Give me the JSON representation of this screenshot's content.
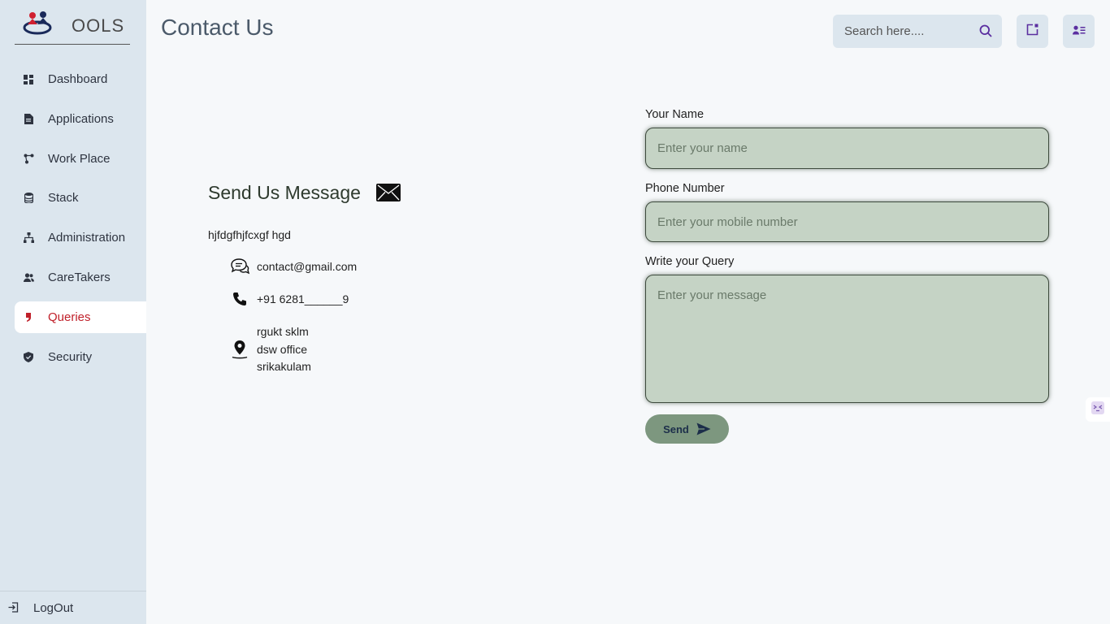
{
  "app": {
    "logo_text": "OOLS"
  },
  "sidebar": {
    "items": [
      {
        "label": "Dashboard",
        "icon": "dashboard-icon"
      },
      {
        "label": "Applications",
        "icon": "document-icon"
      },
      {
        "label": "Work Place",
        "icon": "network-icon"
      },
      {
        "label": "Stack",
        "icon": "database-icon"
      },
      {
        "label": "Administration",
        "icon": "sitemap-icon"
      },
      {
        "label": "CareTakers",
        "icon": "users-icon"
      },
      {
        "label": "Queries",
        "icon": "quote-icon",
        "active": true
      },
      {
        "label": "Security",
        "icon": "shield-icon"
      }
    ],
    "logout_label": "LogOut"
  },
  "header": {
    "title": "Contact Us",
    "search_placeholder": "Search here...."
  },
  "contact_info": {
    "title": "Send Us Message",
    "description": "hjfdgfhjfcxgf hgd",
    "email": "contact@gmail.com",
    "phone": "+91 6281______9",
    "address": [
      "rgukt sklm",
      "dsw office",
      "srikakulam"
    ]
  },
  "form": {
    "name_label": "Your Name",
    "name_placeholder": "Enter your name",
    "phone_label": "Phone Number",
    "phone_placeholder": "Enter your mobile number",
    "query_label": "Write your Query",
    "query_placeholder": "Enter your message",
    "send_label": "Send"
  },
  "colors": {
    "accent": "#c0202a",
    "sidebar_bg": "#dce6ee",
    "input_bg": "#c5d3c5",
    "button_bg": "#7d977f",
    "icon_purple": "#5b2fa0"
  }
}
